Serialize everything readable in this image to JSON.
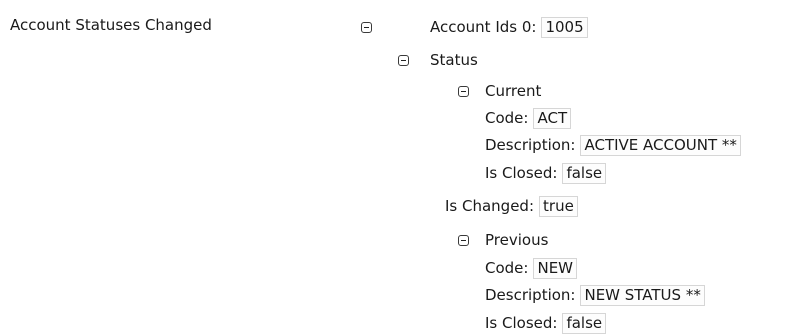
{
  "section_label": "Account Statuses Changed",
  "account_ids": {
    "label": "Account Ids 0:",
    "value": "1005"
  },
  "status": {
    "label": "Status"
  },
  "current": {
    "label": "Current",
    "code": {
      "label": "Code:",
      "value": "ACT"
    },
    "description": {
      "label": "Description:",
      "value": "ACTIVE ACCOUNT **"
    },
    "is_closed": {
      "label": "Is Closed:",
      "value": "false"
    }
  },
  "is_changed": {
    "label": "Is Changed:",
    "value": "true"
  },
  "previous": {
    "label": "Previous",
    "code": {
      "label": "Code:",
      "value": "NEW"
    },
    "description": {
      "label": "Description:",
      "value": "NEW STATUS **"
    },
    "is_closed": {
      "label": "Is Closed:",
      "value": "false"
    }
  },
  "icons": {
    "toggle": "collapse-minus-icon"
  }
}
